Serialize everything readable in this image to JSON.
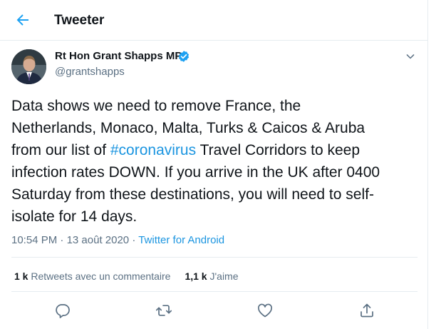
{
  "header": {
    "title": "Tweeter"
  },
  "author": {
    "name": "Rt Hon Grant Shapps MP",
    "handle": "@grantshapps"
  },
  "tweet": {
    "lines": [
      "Data shows we need to remove France, the",
      "Netherlands, Monaco, Malta, Turks & Caicos & Aruba"
    ],
    "line3_prefix": "from our list of ",
    "hashtag": "#coronavirus",
    "line3_suffix": " Travel Corridors to keep",
    "lines_after": [
      "infection rates DOWN. If you arrive in the UK after 0400",
      "Saturday from these destinations, you will need to self-",
      "isolate for 14 days."
    ]
  },
  "meta": {
    "time": "10:54 PM",
    "sep1": " · ",
    "date": "13 août 2020",
    "sep2": " · ",
    "source": "Twitter for Android"
  },
  "stats": {
    "retweets_count": "1 k",
    "retweets_label": " Retweets avec un commentaire",
    "likes_count": "1,1 k",
    "likes_label": " J'aime"
  },
  "colors": {
    "accent": "#1da1f2",
    "secondary_text": "#5b7083",
    "border": "#e6ecf0"
  },
  "icons": [
    "back-arrow-icon",
    "verified-badge-icon",
    "chevron-down-icon",
    "reply-icon",
    "retweet-icon",
    "like-icon",
    "share-icon"
  ]
}
